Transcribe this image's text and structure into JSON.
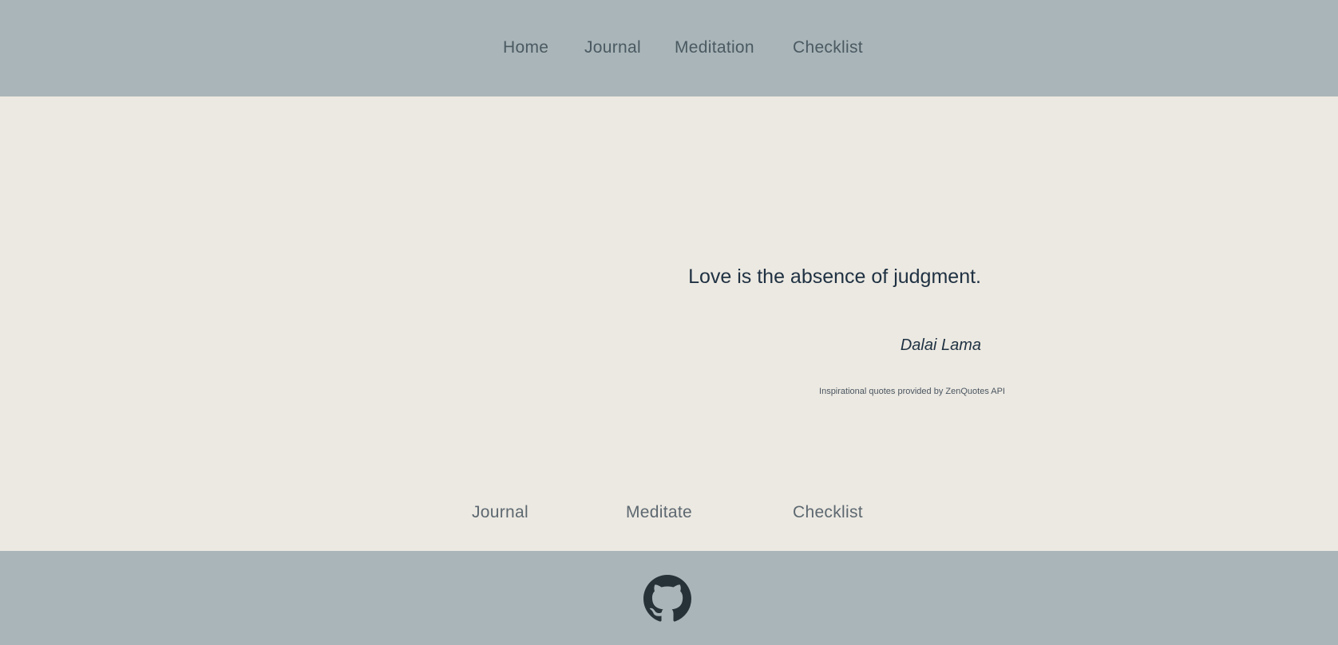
{
  "nav": {
    "items": [
      {
        "label": "Home"
      },
      {
        "label": "Journal"
      },
      {
        "label": "Meditation"
      },
      {
        "label": "Checklist"
      }
    ]
  },
  "quote": {
    "text": "Love is the absence of judgment.",
    "author": "Dalai Lama",
    "attribution": "Inspirational quotes provided by ZenQuotes API"
  },
  "features": {
    "items": [
      {
        "label": "Journal"
      },
      {
        "label": "Meditate"
      },
      {
        "label": "Checklist"
      }
    ]
  },
  "footer": {
    "icon": "github-icon"
  },
  "colors": {
    "header_bg": "#A9B5B8",
    "body_bg": "#ECE9E2",
    "quote_text": "#1F3142",
    "nav_text": "#4B5A62"
  }
}
